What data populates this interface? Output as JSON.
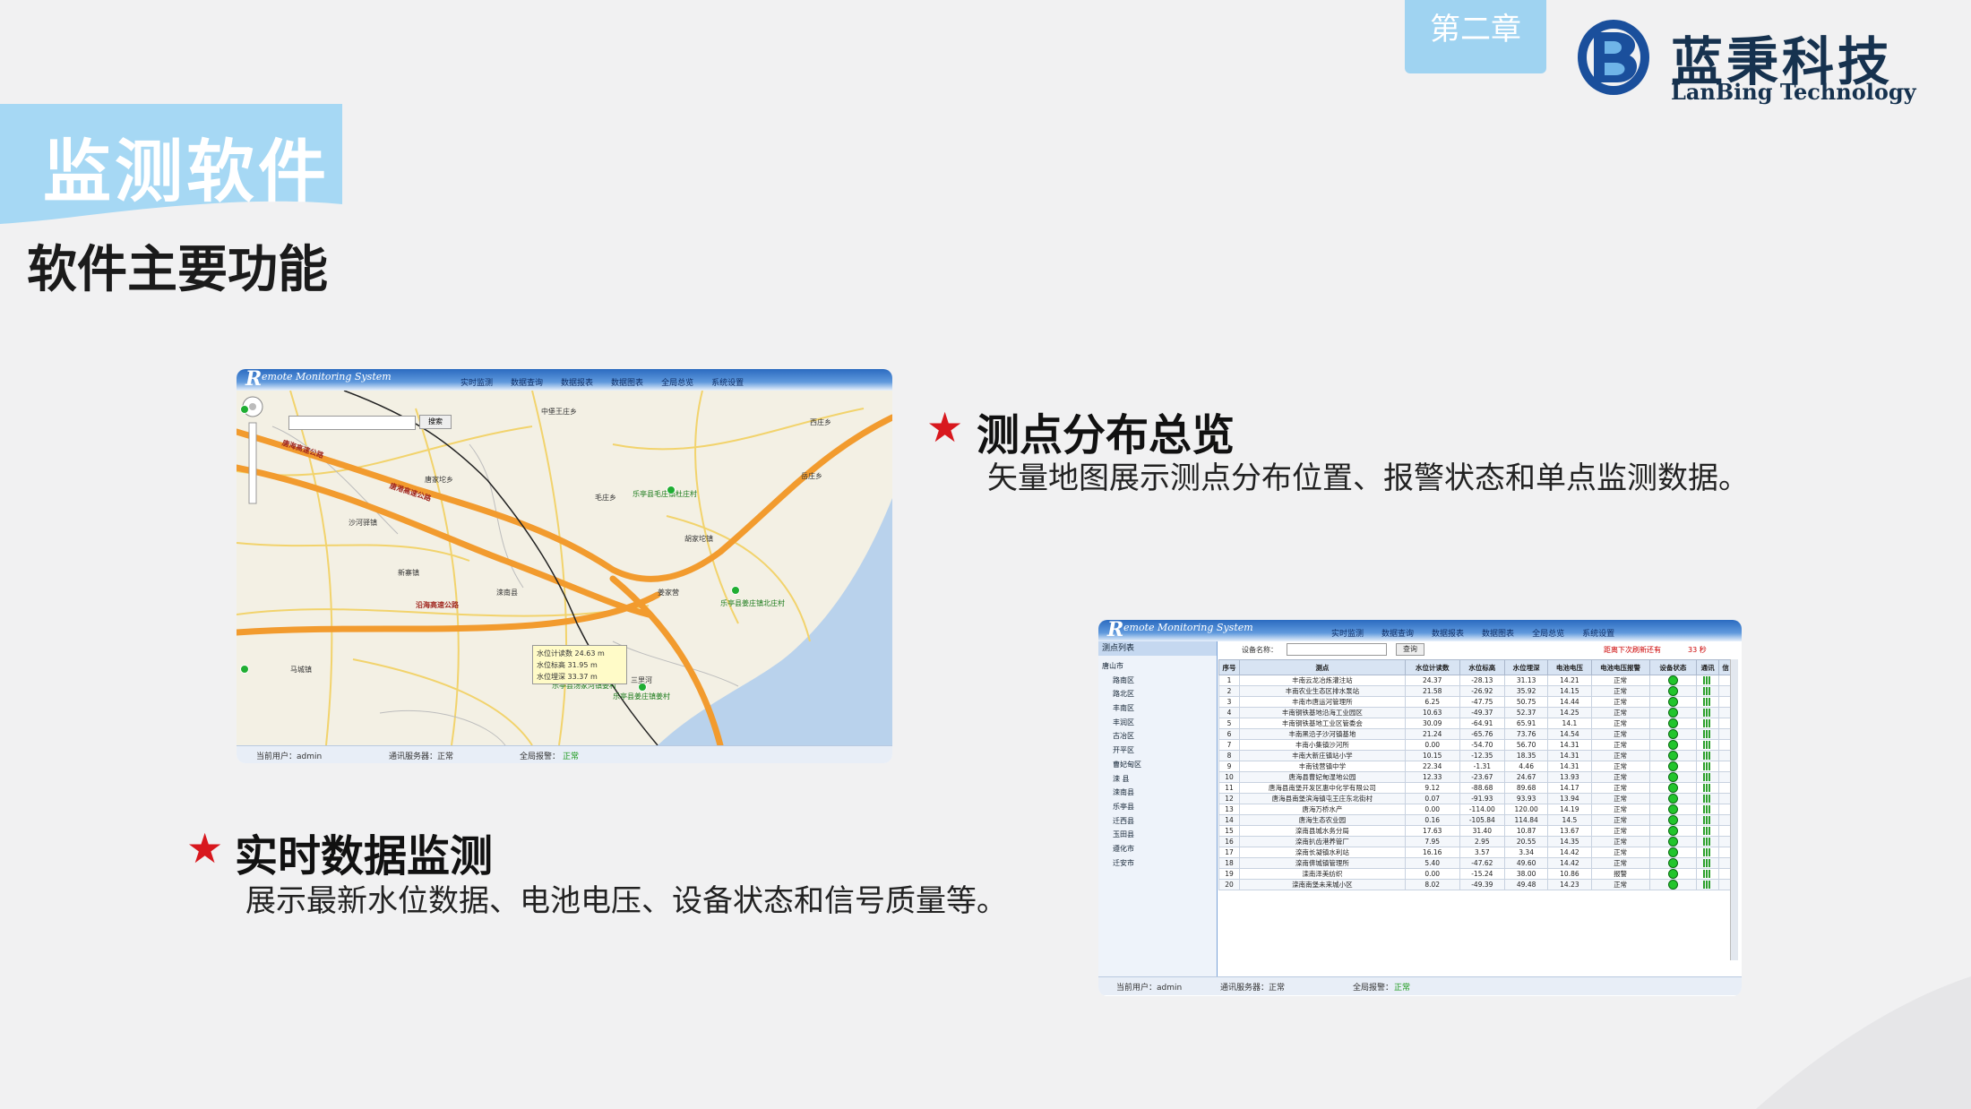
{
  "chapter_tab": "第二章",
  "logo": {
    "cn": "蓝秉科技",
    "en": "LanBing Technology"
  },
  "section_title": "监测软件",
  "subtitle": "软件主要功能",
  "colors": {
    "accent_blue": "#9fd3f1",
    "banner_blue": "#a6d8f4",
    "star_red": "#d8181e",
    "logo_navy": "#16324f"
  },
  "features": [
    {
      "title": "测点分布总览",
      "desc": "矢量地图展示测点分布位置、报警状态和单点监测数据。"
    },
    {
      "title": "实时数据监测",
      "desc": "展示最新水位数据、电池电压、设备状态和信号质量等。"
    }
  ],
  "app": {
    "brand_initial": "R",
    "brand": "emote Monitoring System",
    "nav": [
      "实时监测",
      "数据查询",
      "数据报表",
      "数据图表",
      "全局总览",
      "系统设置"
    ]
  },
  "map_shot": {
    "search_btn": "搜索",
    "tip": [
      "水位计读数 24.63 m",
      "水位标高 31.95 m",
      "水位埋深 33.37 m"
    ],
    "labels": [
      "唐海高速公路",
      "唐港高速公路",
      "沿海高速公路",
      "中堡王庄乡",
      "西庄乡",
      "岳庄乡",
      "乐亭县毛庄镇杜庄村",
      "乐亭县姜庄镇北庄村",
      "乐亭县汤家河镇姜村",
      "乐亭县姜庄镇姜村",
      "毛庄乡",
      "胡家坨镇",
      "新寨镇",
      "滦南县",
      "姜家营",
      "唐家坨乡",
      "沙河驿镇",
      "马城镇",
      "三里河"
    ],
    "status": {
      "user": "当前用户：admin",
      "comm": "通讯服务器：正常",
      "alarm_label": "全局报警：",
      "alarm_value": "正常"
    }
  },
  "table_shot": {
    "panel_title": "测点列表",
    "tree": [
      "唐山市",
      "路南区",
      "路北区",
      "丰南区",
      "丰润区",
      "古冶区",
      "开平区",
      "曹妃甸区",
      "滦  县",
      "滦南县",
      "乐亭县",
      "迁西县",
      "玉田县",
      "遵化市",
      "迁安市"
    ],
    "search_label": "设备名称：",
    "query_btn": "查询",
    "refresh": "距离下次刷新还有",
    "refresh_secs": "33 秒",
    "columns": [
      "序号",
      "测点",
      "水位计读数",
      "水位标高",
      "水位埋深",
      "电池电压",
      "电池电压报警",
      "设备状态",
      "通讯",
      "信"
    ],
    "rows": [
      [
        "1",
        "丰南云龙冶炼灌注站",
        "24.37",
        "-28.13",
        "31.13",
        "14.21",
        "正常"
      ],
      [
        "2",
        "丰南农业生态区排水泵站",
        "21.58",
        "-26.92",
        "35.92",
        "14.15",
        "正常"
      ],
      [
        "3",
        "丰南市唐运河管理所",
        "6.25",
        "-47.75",
        "50.75",
        "14.44",
        "正常"
      ],
      [
        "4",
        "丰南钢铁基地沿海工业园区",
        "10.63",
        "-49.37",
        "52.37",
        "14.25",
        "正常"
      ],
      [
        "5",
        "丰南钢铁基地工业区管委会",
        "30.09",
        "-64.91",
        "65.91",
        "14.1",
        "正常"
      ],
      [
        "6",
        "丰南黑沿子沙河镇基地",
        "21.24",
        "-65.76",
        "73.76",
        "14.54",
        "正常"
      ],
      [
        "7",
        "丰南小集镇沙河所",
        "0.00",
        "-54.70",
        "56.70",
        "14.31",
        "正常"
      ],
      [
        "8",
        "丰南大新庄镇站小学",
        "10.15",
        "-12.35",
        "18.35",
        "14.31",
        "正常"
      ],
      [
        "9",
        "丰南钱营镇中学",
        "22.34",
        "-1.31",
        "4.46",
        "14.31",
        "正常"
      ],
      [
        "10",
        "唐海县曹妃甸湿地公园",
        "12.33",
        "-23.67",
        "24.67",
        "13.93",
        "正常"
      ],
      [
        "11",
        "唐海县南堡开发区惠中化学有限公司",
        "9.12",
        "-88.68",
        "89.68",
        "14.17",
        "正常"
      ],
      [
        "12",
        "唐海县南堡滨海镇屯王庄东北街村",
        "0.07",
        "-91.93",
        "93.93",
        "13.94",
        "正常"
      ],
      [
        "13",
        "唐海万桥水产",
        "0.00",
        "-114.00",
        "120.00",
        "14.19",
        "正常"
      ],
      [
        "14",
        "唐海生态农业园",
        "0.16",
        "-105.84",
        "114.84",
        "14.5",
        "正常"
      ],
      [
        "15",
        "滦南县城水务分局",
        "17.63",
        "31.40",
        "10.87",
        "13.67",
        "正常"
      ],
      [
        "16",
        "滦南扒齿港养管厂",
        "7.95",
        "2.95",
        "20.55",
        "14.35",
        "正常"
      ],
      [
        "17",
        "滦南长凝镇水利站",
        "16.16",
        "3.57",
        "3.34",
        "14.42",
        "正常"
      ],
      [
        "18",
        "滦南倴城镇管理所",
        "5.40",
        "-47.62",
        "49.60",
        "14.42",
        "正常"
      ],
      [
        "19",
        "滦南泽美纺织",
        "0.00",
        "-15.24",
        "38.00",
        "10.86",
        "报警"
      ],
      [
        "20",
        "滦南南堡未来城小区",
        "8.02",
        "-49.39",
        "49.48",
        "14.23",
        "正常"
      ]
    ],
    "status": {
      "user": "当前用户：admin",
      "comm": "通讯服务器：正常",
      "alarm_label": "全局报警：",
      "alarm_value": "正常"
    }
  }
}
